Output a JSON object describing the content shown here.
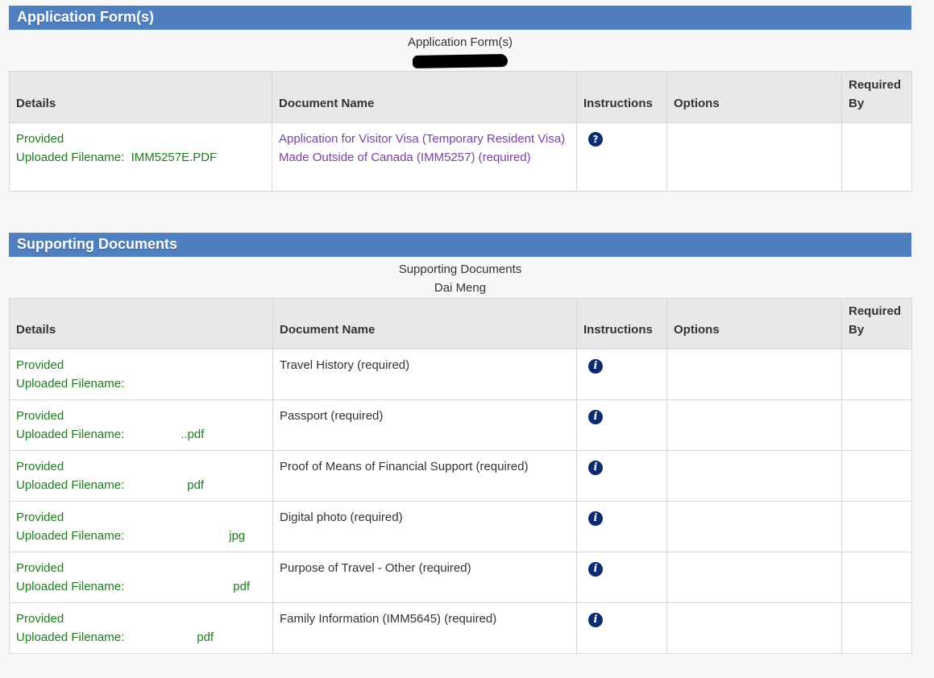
{
  "application_section": {
    "header": "Application Form(s)",
    "caption_line1": "Application Form(s)",
    "columns": [
      "Details",
      "Document Name",
      "Instructions",
      "Options",
      "Required\nBy"
    ],
    "row": {
      "status": "Provided",
      "filename_label": "Uploaded Filename:",
      "filename": "IMM5257E.PDF",
      "document_name": "Application for Visitor Visa (Temporary Resident Visa) Made Outside of Canada (IMM5257) (required)",
      "instructions_icon": "question-circle-icon"
    }
  },
  "supporting_section": {
    "header": "Supporting Documents",
    "caption_line1": "Supporting Documents",
    "caption_line2": "Dai Meng",
    "columns": [
      "Details",
      "Document Name",
      "Instructions",
      "Options",
      "Required\nBy"
    ],
    "rows": [
      {
        "status": "Provided",
        "filename_label": "Uploaded Filename:",
        "filename_suffix": "",
        "document_name": "Travel History  (required)",
        "instructions_icon": "info-circle-icon"
      },
      {
        "status": "Provided",
        "filename_label": "Uploaded Filename:",
        "filename_suffix": "..pdf",
        "document_name": "Passport  (required)",
        "instructions_icon": "info-circle-icon"
      },
      {
        "status": "Provided",
        "filename_label": "Uploaded Filename:",
        "filename_suffix": "pdf",
        "document_name": "Proof of Means of Financial Support  (required)",
        "instructions_icon": "info-circle-icon"
      },
      {
        "status": "Provided",
        "filename_label": "Uploaded Filename:",
        "filename_suffix": "jpg",
        "document_name": "Digital photo  (required)",
        "instructions_icon": "info-circle-icon"
      },
      {
        "status": "Provided",
        "filename_label": "Uploaded Filename:",
        "filename_suffix": "pdf",
        "document_name": "Purpose of Travel - Other  (required)",
        "instructions_icon": "info-circle-icon"
      },
      {
        "status": "Provided",
        "filename_label": "Uploaded Filename:",
        "filename_suffix": "pdf",
        "document_name": "Family Information (IMM5645)  (required)",
        "instructions_icon": "info-circle-icon"
      }
    ]
  },
  "colors": {
    "header_bg": "#4f7fbf",
    "status_green": "#1e7a1e",
    "link_purple": "#7b3fa6",
    "icon_navy": "#0b2a6f"
  }
}
